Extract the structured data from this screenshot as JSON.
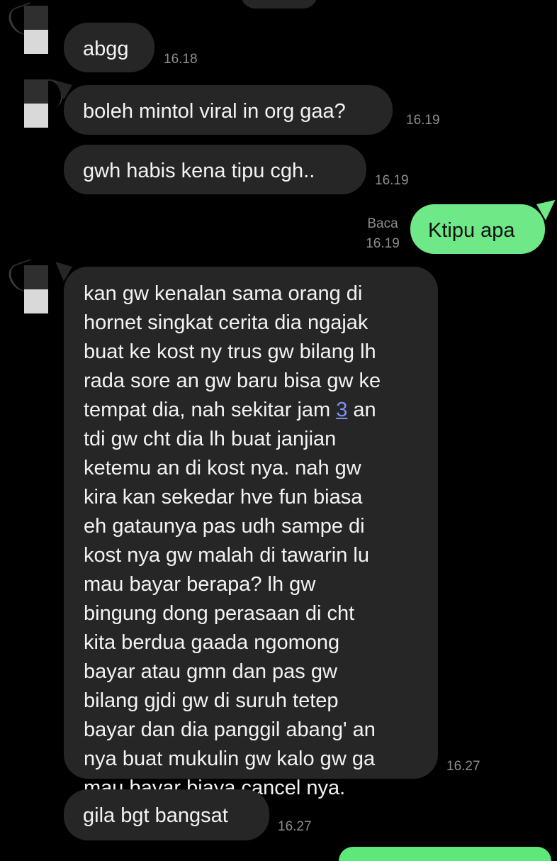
{
  "messages": [
    {
      "sender": "other",
      "text": "abgg",
      "time": "16.18"
    },
    {
      "sender": "other",
      "text": "boleh mintol viral in org gaa?",
      "time": "16.19"
    },
    {
      "sender": "other",
      "text": "gwh habis kena tipu cgh..",
      "time": "16.19"
    },
    {
      "sender": "me",
      "text": "Ktipu apa",
      "read_label": "Baca",
      "time": "16.19"
    },
    {
      "sender": "other",
      "lines": [
        "kan gw kenalan sama orang di",
        "hornet singkat cerita dia ngajak",
        "buat ke kost ny trus gw bilang lh",
        "rada sore an gw baru bisa gw ke",
        "tdi gw cht dia lh buat janjian",
        "ketemu an di kost nya. nah gw",
        "kira kan sekedar hve fun biasa",
        "eh gataunya pas udh sampe di",
        "kost nya gw malah di tawarin lu",
        "mau bayar berapa? lh gw",
        "bingung dong perasaan di cht",
        "kita berdua gaada ngomong",
        "bayar atau gmn dan pas gw",
        "bilang gjdi gw di suruh tetep",
        "bayar dan dia panggil abang' an",
        "nya buat mukulin gw kalo gw ga",
        "mau bayar biaya cancel nya."
      ],
      "link_line": {
        "before": "tempat dia, nah sekitar jam ",
        "link": "3",
        "after": " an"
      },
      "time": "16.27"
    },
    {
      "sender": "other",
      "text": "gila bgt bangsat",
      "time": "16.27"
    }
  ],
  "colors": {
    "background": "#000000",
    "incoming_bubble": "#262626",
    "outgoing_bubble": "#6fe887",
    "link": "#7f8ff5",
    "timestamp": "#8e8e8e"
  }
}
